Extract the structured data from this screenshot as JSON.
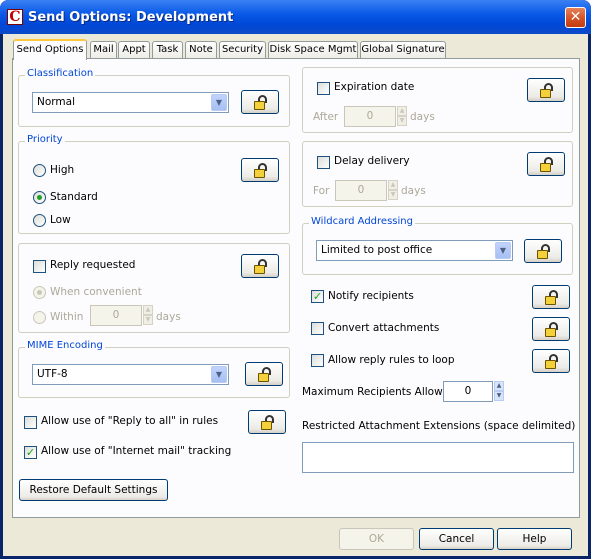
{
  "window": {
    "title": "Send Options:  Development",
    "app_icon": "C",
    "close_glyph": "✕"
  },
  "tabs": [
    {
      "label": "Send Options",
      "active": true
    },
    {
      "label": "Mail"
    },
    {
      "label": "Appt"
    },
    {
      "label": "Task"
    },
    {
      "label": "Note"
    },
    {
      "label": "Security"
    },
    {
      "label": "Disk Space Mgmt"
    },
    {
      "label": "Global Signature"
    }
  ],
  "classification": {
    "legend": "Classification",
    "value": "Normal"
  },
  "priority": {
    "legend": "Priority",
    "options": [
      "High",
      "Standard",
      "Low"
    ],
    "selected": "Standard"
  },
  "reply": {
    "label": "Reply requested",
    "checked": false,
    "when_convenient": "When convenient",
    "within": "Within",
    "within_value": "0",
    "days": "days"
  },
  "mime": {
    "legend": "MIME Encoding",
    "value": "UTF-8"
  },
  "allow_reply_all": {
    "label": "Allow use of  \"Reply to all\" in rules",
    "checked": false
  },
  "allow_internet_tracking": {
    "label": "Allow use of  \"Internet mail\" tracking",
    "checked": true
  },
  "restore_button": "Restore Default Settings",
  "expiration": {
    "label": "Expiration date",
    "checked": false,
    "prefix": "After",
    "value": "0",
    "unit": "days"
  },
  "delay": {
    "label": "Delay delivery",
    "checked": false,
    "prefix": "For",
    "value": "0",
    "unit": "days"
  },
  "wildcard": {
    "legend": "Wildcard Addressing",
    "value": "Limited to post office"
  },
  "notify": {
    "label": "Notify recipients",
    "checked": true
  },
  "convert": {
    "label": "Convert attachments",
    "checked": false
  },
  "reply_loop": {
    "label": "Allow reply rules to loop",
    "checked": false
  },
  "max_recipients": {
    "label": "Maximum Recipients Allowed",
    "value": "0"
  },
  "restricted": {
    "label": "Restricted Attachment Extensions (space delimited)",
    "value": ""
  },
  "footer": {
    "ok": "OK",
    "cancel": "Cancel",
    "help": "Help"
  },
  "check_glyph": "✓",
  "arrows": {
    "down": "▼",
    "up": "▲"
  },
  "colors": {
    "legend": "#0046d5",
    "titlebar": "#0a5ae8",
    "check": "#21a121",
    "lock": "#f4d13a"
  }
}
